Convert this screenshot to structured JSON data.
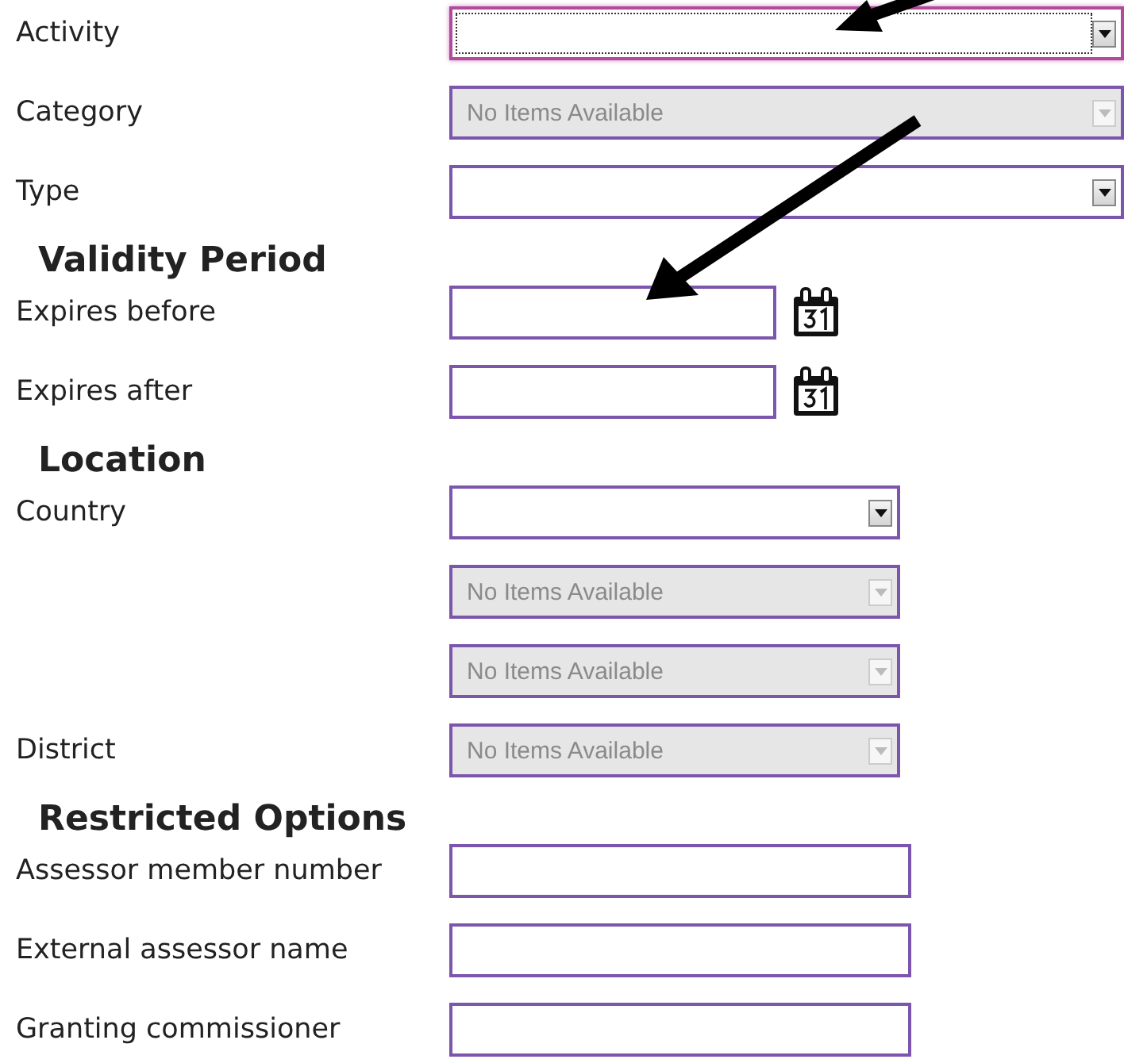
{
  "sections": [
    {
      "fields": [
        {
          "kind": "dropdown",
          "label": "Activity",
          "focused": true,
          "disabled": false
        },
        {
          "kind": "dropdown",
          "label": "Category",
          "value": "No Items Available",
          "focused": false,
          "disabled": true
        },
        {
          "kind": "dropdown",
          "label": "Type",
          "focused": false,
          "disabled": false
        }
      ]
    },
    {
      "heading": "Validity Period",
      "fields": [
        {
          "kind": "date",
          "label": "Expires before"
        },
        {
          "kind": "date",
          "label": "Expires after"
        }
      ]
    },
    {
      "heading": "Location",
      "fields": [
        {
          "kind": "dropdown",
          "label": "Country",
          "focused": false,
          "disabled": false
        },
        {
          "kind": "dropdown",
          "value": "No Items Available",
          "focused": false,
          "disabled": true
        },
        {
          "kind": "dropdown",
          "value": "No Items Available",
          "focused": false,
          "disabled": true
        },
        {
          "kind": "dropdown",
          "label": "District",
          "value": "No Items Available",
          "focused": false,
          "disabled": true
        }
      ]
    },
    {
      "heading": "Restricted Options",
      "fields": [
        {
          "kind": "text",
          "label": "Assessor member number"
        },
        {
          "kind": "text",
          "label": "External assessor name"
        },
        {
          "kind": "text",
          "label": "Granting commissioner"
        }
      ]
    }
  ]
}
